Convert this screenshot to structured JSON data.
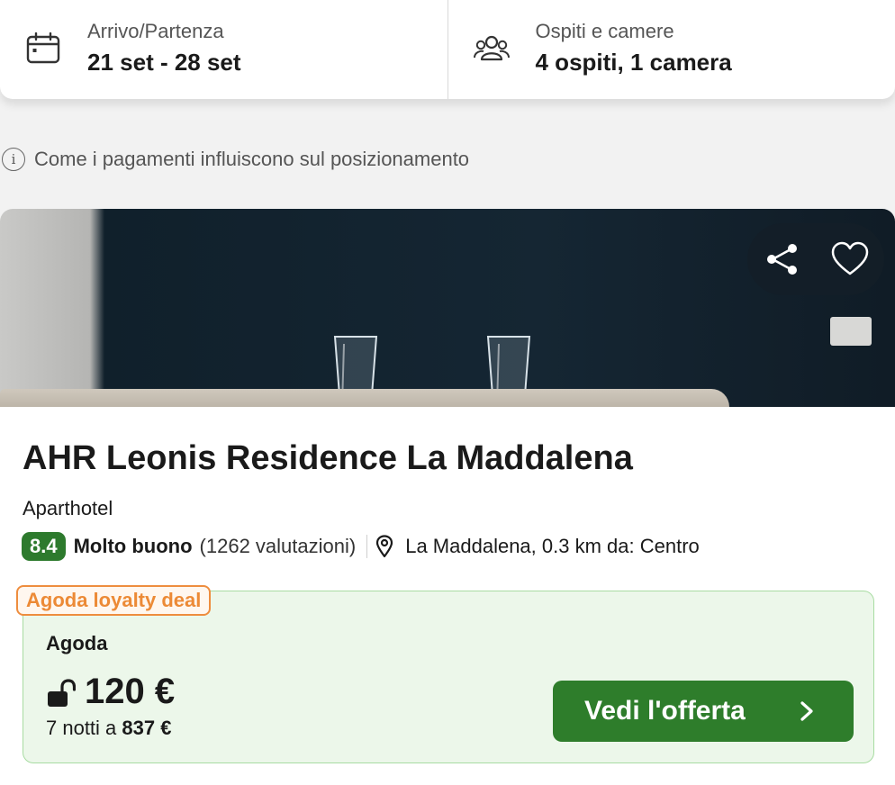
{
  "search": {
    "dates": {
      "label": "Arrivo/Partenza",
      "value": "21 set - 28 set",
      "icon": "calendar-icon"
    },
    "guests": {
      "label": "Ospiti e camere",
      "value": "4 ospiti, 1 camera",
      "icon": "people-icon"
    }
  },
  "info_link": {
    "text": "Come i pagamenti influiscono sul posizionamento",
    "icon": "info-icon"
  },
  "hotel": {
    "name": "AHR Leonis Residence La Maddalena",
    "type": "Aparthotel",
    "score": "8.4",
    "rating_word": "Molto buono",
    "reviews": "(1262 valutazioni)",
    "location": "La Maddalena, 0.3 km da: Centro",
    "actions": {
      "share_icon": "share-icon",
      "favorite_icon": "heart-icon"
    }
  },
  "deal": {
    "badge": "Agoda loyalty deal",
    "provider": "Agoda",
    "price": "120 €",
    "nights_prefix": "7 notti a",
    "total": "837 €",
    "cta": "Vedi l'offerta"
  },
  "colors": {
    "score_green": "#2d7a2d",
    "cta_green": "#2e7d2b",
    "deal_bg": "#ecf7ea",
    "loyalty_orange": "#ec8a36"
  }
}
